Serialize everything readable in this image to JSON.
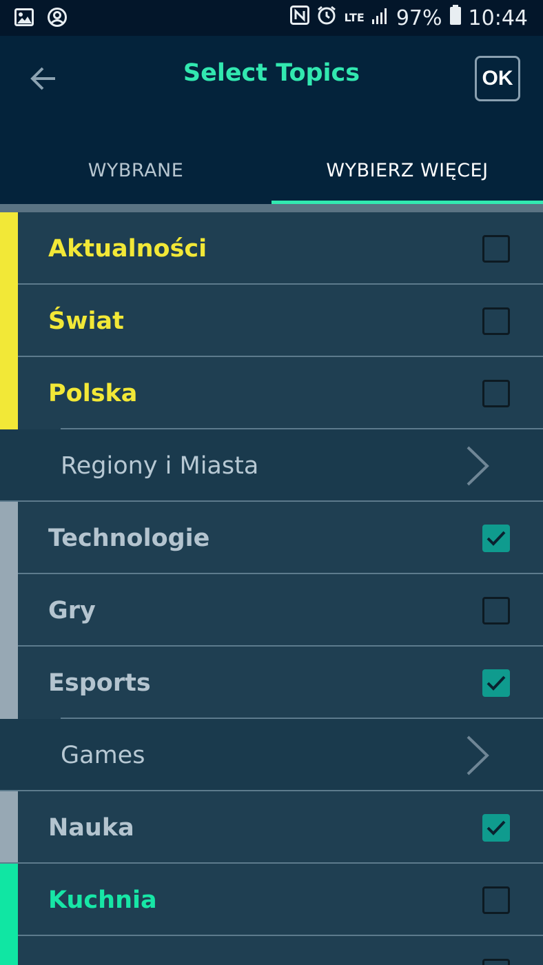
{
  "status_bar": {
    "battery": "97%",
    "time": "10:44",
    "network": "LTE",
    "icons": [
      "image-icon",
      "account-circle-icon",
      "nfc-icon",
      "alarm-icon",
      "lte-icon",
      "signal-icon",
      "battery-icon"
    ]
  },
  "header": {
    "title": "Select Topics",
    "ok_label": "OK",
    "back_icon": "arrow-left-icon"
  },
  "tabs": [
    {
      "label": "WYBRANE",
      "active": false
    },
    {
      "label": "WYBIERZ WIĘCEJ",
      "active": true
    }
  ],
  "colors": {
    "accent": "#32e8b0",
    "yellow": "#f2e837",
    "gray_stripe": "#97a8b4",
    "teal_stripe": "#10e6a3",
    "check": "#0f9b8e"
  },
  "topics": [
    {
      "label": "Aktualności",
      "checked": false,
      "color": "#f2e837"
    },
    {
      "label": "Świat",
      "checked": false,
      "color": "#f2e837"
    },
    {
      "label": "Polska",
      "checked": false,
      "color": "#f2e837"
    },
    {
      "label": "Regiony i Miasta",
      "sub": true
    },
    {
      "label": "Technologie",
      "checked": true,
      "color": "#b4c4cf"
    },
    {
      "label": "Gry",
      "checked": false,
      "color": "#b4c4cf"
    },
    {
      "label": "Esports",
      "checked": true,
      "color": "#b4c4cf"
    },
    {
      "label": "Games",
      "sub": true
    },
    {
      "label": "Nauka",
      "checked": true,
      "color": "#b4c4cf"
    },
    {
      "label": "Kuchnia",
      "checked": false,
      "color": "#17e6a6"
    }
  ]
}
